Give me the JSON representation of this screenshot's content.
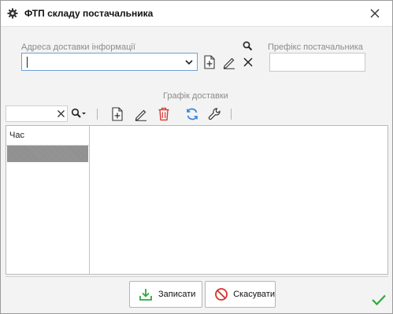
{
  "window": {
    "title": "ФТП складу постачальника",
    "title_icon": "gear-icon",
    "close_icon": "close-icon"
  },
  "form": {
    "address_label": "Адреса доставки інформації",
    "address_value": "",
    "prefix_label": "Префікс постачальника",
    "prefix_value": ""
  },
  "schedule": {
    "label": "Графік доставки",
    "search_value": "",
    "columns": [
      "Час"
    ]
  },
  "footer": {
    "save_label": "Записати",
    "cancel_label": "Скасувати"
  },
  "colors": {
    "accent_green": "#2eaa3c",
    "delete_red": "#d9302c",
    "refresh_blue": "#2a83d6",
    "focus_border": "#6fa0d6"
  }
}
